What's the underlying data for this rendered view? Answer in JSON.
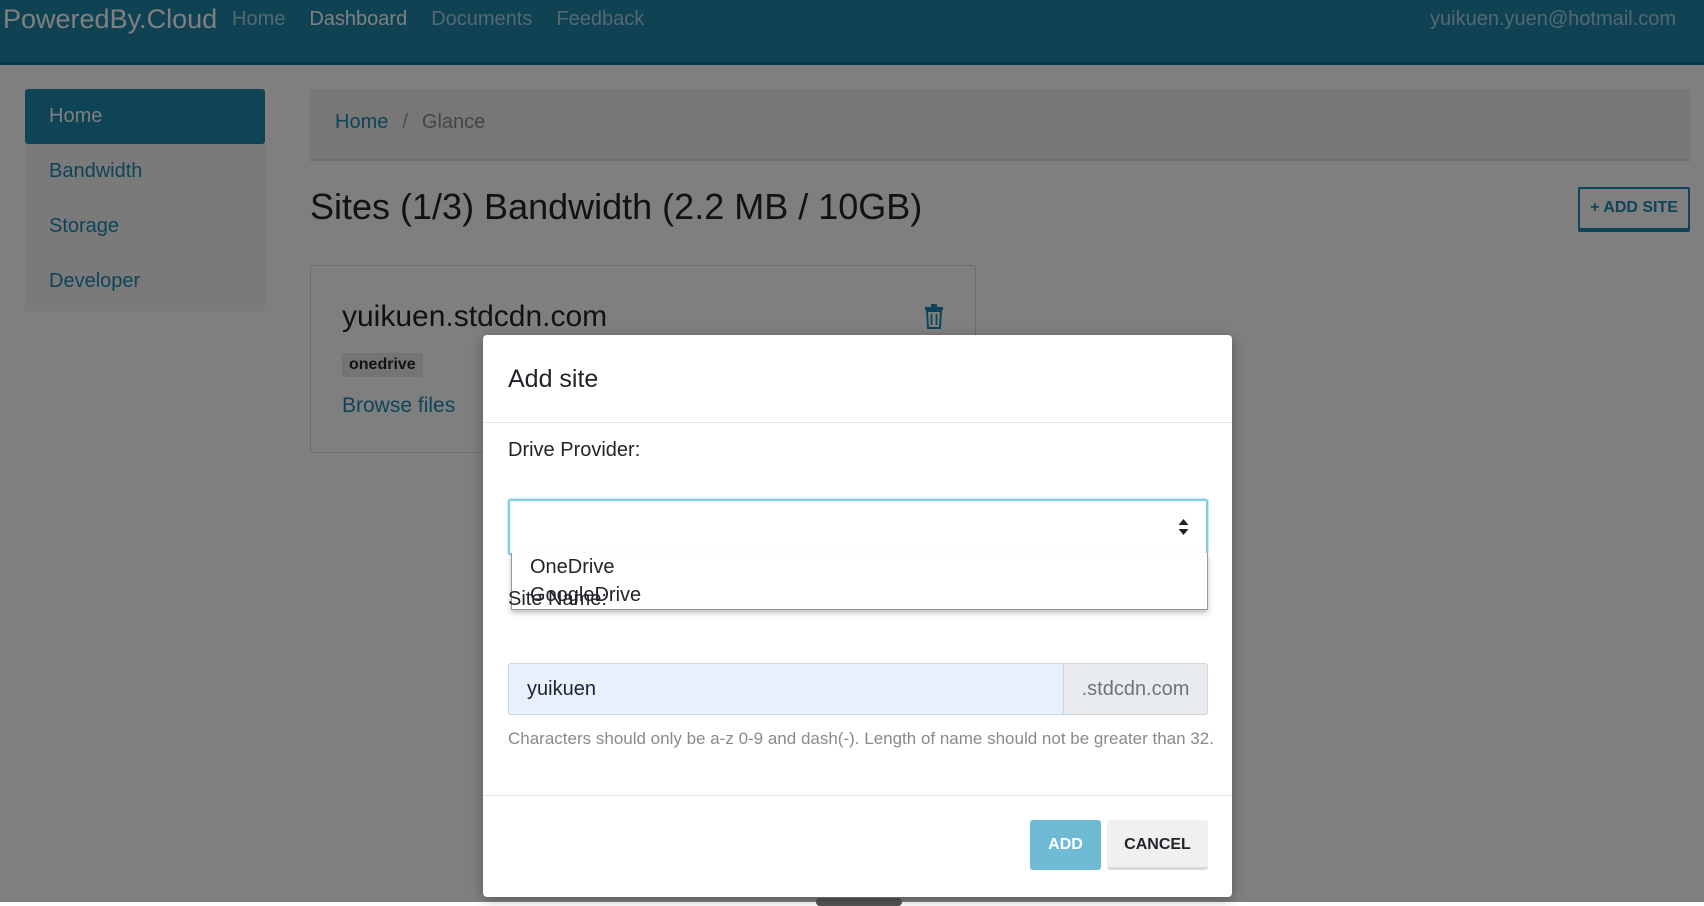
{
  "navbar": {
    "brand": "PoweredBy.Cloud",
    "links": [
      "Home",
      "Dashboard",
      "Documents",
      "Feedback"
    ],
    "active_link": "Dashboard",
    "user_email": "yuikuen.yuen@hotmail.com"
  },
  "sidebar": {
    "items": [
      {
        "label": "Home",
        "active": true
      },
      {
        "label": "Bandwidth",
        "active": false
      },
      {
        "label": "Storage",
        "active": false
      },
      {
        "label": "Developer",
        "active": false
      }
    ]
  },
  "breadcrumb": {
    "home": "Home",
    "separator": "/",
    "current": "Glance"
  },
  "main": {
    "heading": "Sites (1/3) Bandwidth (2.2 MB / 10GB)",
    "add_site_label": "+ ADD SITE"
  },
  "site_card": {
    "domain": "yuikuen.stdcdn.com",
    "provider_badge": "onedrive",
    "browse_link": "Browse files",
    "delete_icon": "trash-icon"
  },
  "modal": {
    "title": "Add site",
    "drive_provider_label": "Drive Provider:",
    "drive_provider_value": "",
    "drive_provider_options": [
      "OneDrive",
      "GoogleDrive"
    ],
    "site_name_label": "Site Name:",
    "site_name_value": "yuikuen",
    "site_name_suffix": ".stdcdn.com",
    "help_text": "Characters should only be a-z 0-9 and dash(-). Length of name should not be greater than 32.",
    "add_label": "ADD",
    "cancel_label": "CANCEL"
  },
  "colors": {
    "primary": "#1f86a8",
    "link": "#1b88b3",
    "add_button": "#6fbad4"
  }
}
